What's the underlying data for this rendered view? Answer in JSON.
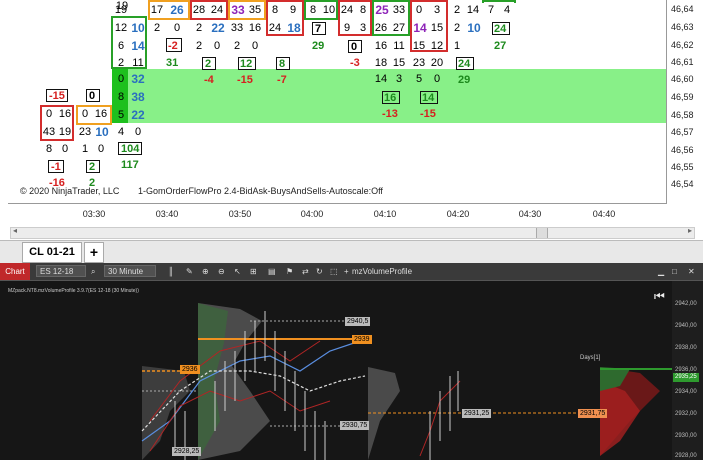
{
  "top_chart": {
    "price_labels": [
      "46,64",
      "46,63",
      "46,62",
      "46,61",
      "46,60",
      "46,59",
      "46,58",
      "46,57",
      "46,56",
      "46,55",
      "46,54"
    ],
    "time_labels": [
      "03:30",
      "03:40",
      "03:50",
      "04:00",
      "04:10",
      "04:20",
      "04:30",
      "04:40"
    ],
    "copyright": "© 2020 NinjaTrader, LLC",
    "indicator": "1-GomOrderFlowPro 2.4-BidAsk-BuysAndSells-Autoscale:Off",
    "tab_label": "CL 01-21",
    "add_tab": "+",
    "cells": {
      "c1": [
        "19",
        "12",
        "6",
        "2",
        "0",
        "8",
        "5",
        "4",
        "1"
      ],
      "c1b": [
        "18",
        "10",
        "14",
        "11",
        "32",
        "38",
        "22",
        "0",
        "0"
      ],
      "c2": [
        "17",
        "2",
        "2"
      ],
      "c2b": [
        "26",
        "0",
        "0"
      ],
      "c3": [
        "28",
        "22",
        "2"
      ],
      "c3b": [
        "24",
        "0",
        "6"
      ],
      "c4": [
        "33",
        "33",
        "2"
      ],
      "c4b": [
        "35",
        "16",
        "0"
      ],
      "c5": [
        "8",
        "24",
        "8"
      ],
      "c5b": [
        "9",
        "18",
        "6"
      ],
      "c6": [
        "8",
        "2"
      ],
      "c6b": [
        "10",
        "0"
      ],
      "c7": [
        "24",
        "9"
      ],
      "c7b": [
        "8",
        "3"
      ],
      "c8": [
        "25",
        "26",
        "16",
        "18",
        "14"
      ],
      "c8b": [
        "33",
        "27",
        "11",
        "15",
        "3"
      ],
      "c9": [
        "0",
        "14",
        "15",
        "23",
        "5"
      ],
      "c9b": [
        "3",
        "15",
        "12",
        "20",
        "0"
      ],
      "c10": [
        "2",
        "2",
        "1"
      ],
      "c10b": [
        "14",
        "10",
        "0"
      ],
      "c11": [
        "7"
      ],
      "c11b": [
        "4"
      ],
      "left1": [
        "0",
        "43",
        "8"
      ],
      "left1b": [
        "16",
        "19",
        "0"
      ],
      "left2": [
        "0",
        "23",
        "1"
      ],
      "left2b": [
        "16",
        "10",
        "0"
      ]
    },
    "delta_boxes": [
      "-15",
      "0",
      "-2",
      "2",
      "12",
      "8",
      "7",
      "0",
      "16",
      "14",
      "24",
      "24",
      "104",
      "2"
    ],
    "delta_values": [
      "31",
      "-4",
      "-15",
      "-7",
      "29",
      "-3",
      "-13",
      "-15",
      "29",
      "27",
      "117",
      "-16",
      "2",
      "-1"
    ]
  },
  "bottom_chart": {
    "title_button": "Chart",
    "instrument": "ES 12-18",
    "interval": "30 Minute",
    "indicator_name": "mzVolumeProfile",
    "header_text": "MZpack.NT8.mzVolumeProfile 3.9.7(ES 12-18 (30 Minute))",
    "days_label": "Days[1]",
    "price_labels": [
      "2942,00",
      "2940,00",
      "2938,00",
      "2936,00",
      "2934,00",
      "2932,00",
      "2930,00",
      "2928,00"
    ],
    "level_labels": [
      "2940,5",
      "2939",
      "2936",
      "2930,75",
      "2928,25",
      "2931,25",
      "2931,75",
      "2935,25"
    ]
  },
  "colors": {
    "band": "#88f088",
    "negative": "#d62020",
    "positive": "#1d8a1d",
    "blue_value": "#2a6fbf",
    "purple_value": "#8d23b8"
  }
}
